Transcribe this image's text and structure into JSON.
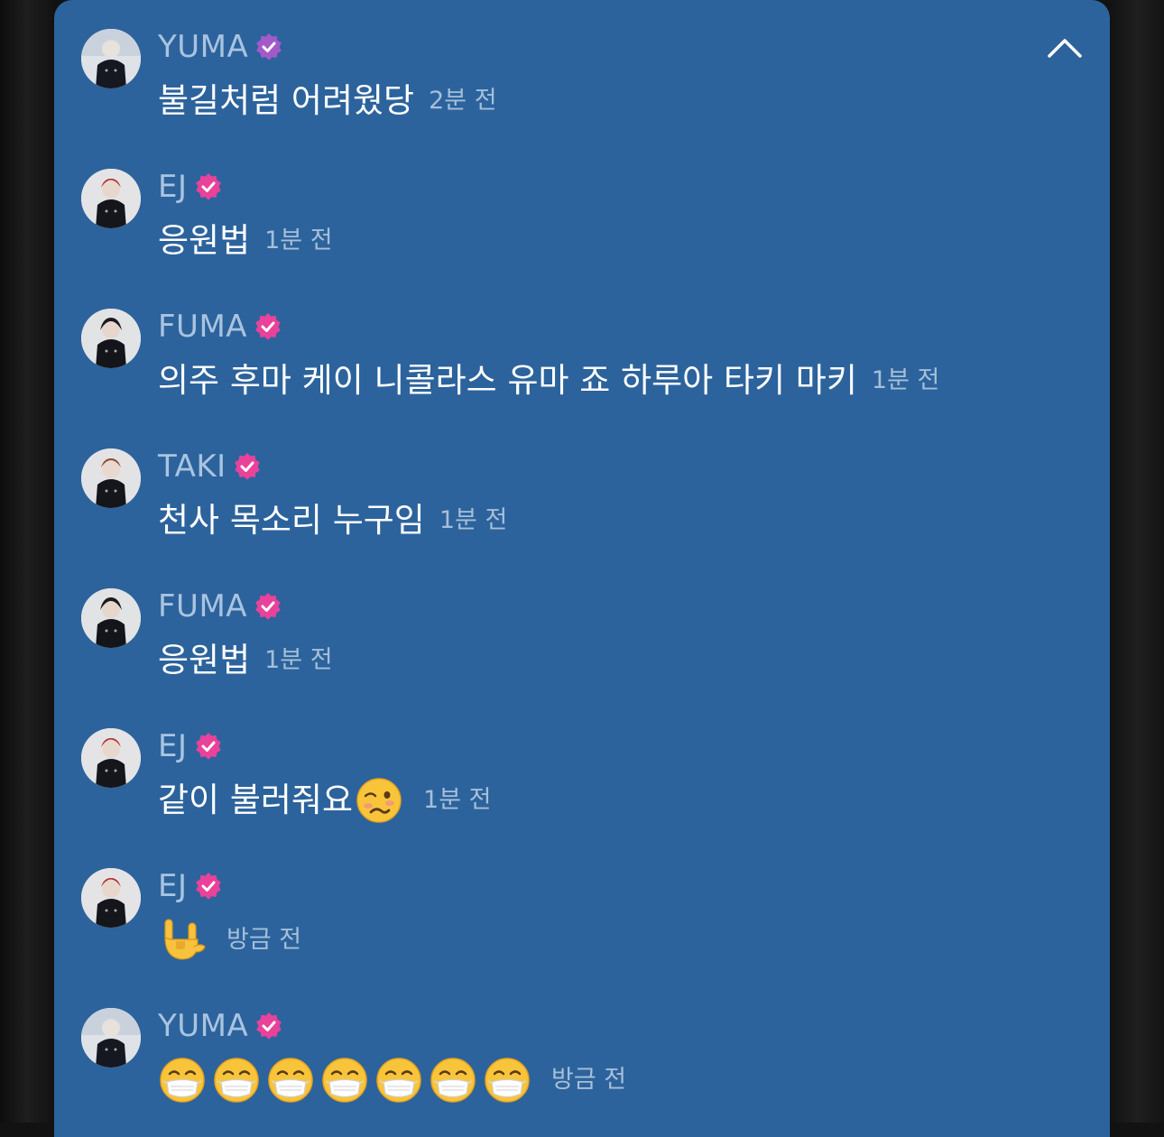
{
  "chat": {
    "collapse_icon": "chevron-up-icon",
    "messages": [
      {
        "user": "YUMA",
        "text": "불길처럼 어려웠당",
        "time": "2분 전",
        "badge_color": "#a35ac9"
      },
      {
        "user": "EJ",
        "text": "응원법",
        "time": "1분 전",
        "badge_color": "#e8429a"
      },
      {
        "user": "FUMA",
        "text": "의주 후마 케이 니콜라스 유마 죠 하루아 타키 마키",
        "time": "1분 전",
        "badge_color": "#e8429a"
      },
      {
        "user": "TAKI",
        "text": "천사 목소리 누구임",
        "time": "1분 전",
        "badge_color": "#e8429a"
      },
      {
        "user": "FUMA",
        "text": "응원법",
        "time": "1분 전",
        "badge_color": "#e8429a"
      },
      {
        "user": "EJ",
        "text": "같이 불러줘요",
        "time": "1분 전",
        "badge_color": "#e8429a",
        "emoji": "woozy-face"
      },
      {
        "user": "EJ",
        "text": "",
        "time": "방금 전",
        "badge_color": "#e8429a",
        "emoji": "love-you-gesture"
      },
      {
        "user": "YUMA",
        "text": "",
        "time": "방금 전",
        "badge_color": "#e8429a",
        "emoji": "face-with-medical-mask",
        "emoji_count": 7
      }
    ]
  }
}
